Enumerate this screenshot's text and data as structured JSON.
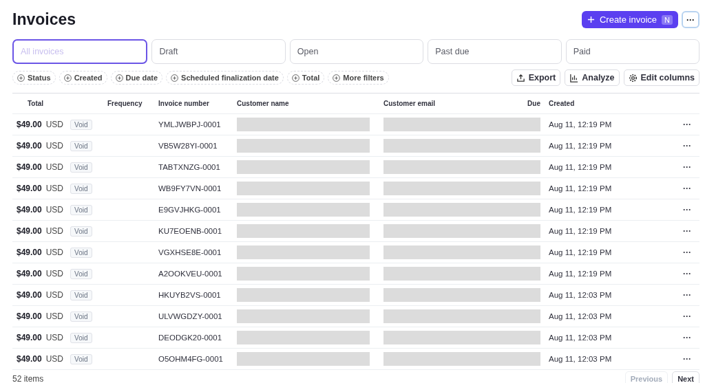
{
  "title": "Invoices",
  "actions": {
    "create": {
      "label": "Create invoice",
      "shortcut": "N"
    },
    "more": "···"
  },
  "tabs": [
    {
      "label": "All invoices",
      "selected": true
    },
    {
      "label": "Draft",
      "selected": false
    },
    {
      "label": "Open",
      "selected": false
    },
    {
      "label": "Past due",
      "selected": false
    },
    {
      "label": "Paid",
      "selected": false
    }
  ],
  "filters": [
    "Status",
    "Created",
    "Due date",
    "Scheduled finalization date",
    "Total",
    "More filters"
  ],
  "toolbar": [
    {
      "kind": "export",
      "label": "Export"
    },
    {
      "kind": "analyze",
      "label": "Analyze"
    },
    {
      "kind": "columns",
      "label": "Edit columns"
    }
  ],
  "table": {
    "columns": [
      "Total",
      "Frequency",
      "Invoice number",
      "Customer name",
      "Customer email",
      "Due",
      "Created"
    ],
    "rows": [
      {
        "amount": "$49.00",
        "currency": "USD",
        "status": "Void",
        "number": "YMLJWBPJ-0001",
        "created": "Aug 11, 12:19 PM",
        "menu": "···"
      },
      {
        "amount": "$49.00",
        "currency": "USD",
        "status": "Void",
        "number": "VB5W28YI-0001",
        "created": "Aug 11, 12:19 PM",
        "menu": "···"
      },
      {
        "amount": "$49.00",
        "currency": "USD",
        "status": "Void",
        "number": "TABTXNZG-0001",
        "created": "Aug 11, 12:19 PM",
        "menu": "···"
      },
      {
        "amount": "$49.00",
        "currency": "USD",
        "status": "Void",
        "number": "WB9FY7VN-0001",
        "created": "Aug 11, 12:19 PM",
        "menu": "···"
      },
      {
        "amount": "$49.00",
        "currency": "USD",
        "status": "Void",
        "number": "E9GVJHKG-0001",
        "created": "Aug 11, 12:19 PM",
        "menu": "···"
      },
      {
        "amount": "$49.00",
        "currency": "USD",
        "status": "Void",
        "number": "KU7EOENB-0001",
        "created": "Aug 11, 12:19 PM",
        "menu": "···"
      },
      {
        "amount": "$49.00",
        "currency": "USD",
        "status": "Void",
        "number": "VGXHSE8E-0001",
        "created": "Aug 11, 12:19 PM",
        "menu": "···"
      },
      {
        "amount": "$49.00",
        "currency": "USD",
        "status": "Void",
        "number": "A2OOKVEU-0001",
        "created": "Aug 11, 12:19 PM",
        "menu": "···"
      },
      {
        "amount": "$49.00",
        "currency": "USD",
        "status": "Void",
        "number": "HKUYB2VS-0001",
        "created": "Aug 11, 12:03 PM",
        "menu": "···"
      },
      {
        "amount": "$49.00",
        "currency": "USD",
        "status": "Void",
        "number": "ULVWGDZY-0001",
        "created": "Aug 11, 12:03 PM",
        "menu": "···"
      },
      {
        "amount": "$49.00",
        "currency": "USD",
        "status": "Void",
        "number": "DEODGK20-0001",
        "created": "Aug 11, 12:03 PM",
        "menu": "···"
      },
      {
        "amount": "$49.00",
        "currency": "USD",
        "status": "Void",
        "number": "O5OHM4FG-0001",
        "created": "Aug 11, 12:03 PM",
        "menu": "···"
      }
    ]
  },
  "footer": {
    "count": "52 items",
    "previous": {
      "label": "Previous",
      "disabled": true
    },
    "next": {
      "label": "Next",
      "disabled": false
    }
  }
}
